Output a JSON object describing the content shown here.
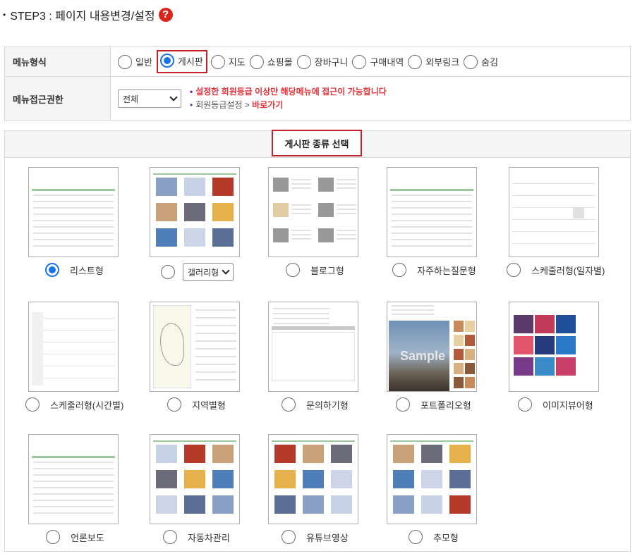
{
  "step": {
    "bullet": "•",
    "title": "STEP3 : 페이지 내용변경/설정",
    "help_icon": "question-icon"
  },
  "menu_type": {
    "label": "메뉴형식",
    "options": [
      "일반",
      "게시판",
      "지도",
      "쇼핑몰",
      "장바구니",
      "구매내역",
      "외부링크",
      "숨김"
    ],
    "selected": "게시판"
  },
  "access": {
    "label": "메뉴접근권한",
    "select_value": "전체",
    "note1": "설정한 회원등급 이상만 해당메뉴에 접근이 가능합니다",
    "note2_prefix": "회원등급설정 >",
    "note2_link": "바로가기"
  },
  "board": {
    "title": "게시판 종류 선택",
    "selected": "리스트형",
    "gallery_select": "갤러리형",
    "types": [
      "리스트형",
      "갤러리형",
      "블로그형",
      "자주하는질문형",
      "스케줄러형(일자별)",
      "스케줄러형(시간별)",
      "지역별형",
      "문의하기형",
      "포트폴리오형",
      "이미지뷰어형",
      "언론보도",
      "자동차관리",
      "유튜브영상",
      "추모형"
    ],
    "portfolio_watermark": "Sample"
  },
  "colors": {
    "accent": "#1a73e8",
    "highlight": "#c3222b",
    "note": "#e6343b"
  }
}
